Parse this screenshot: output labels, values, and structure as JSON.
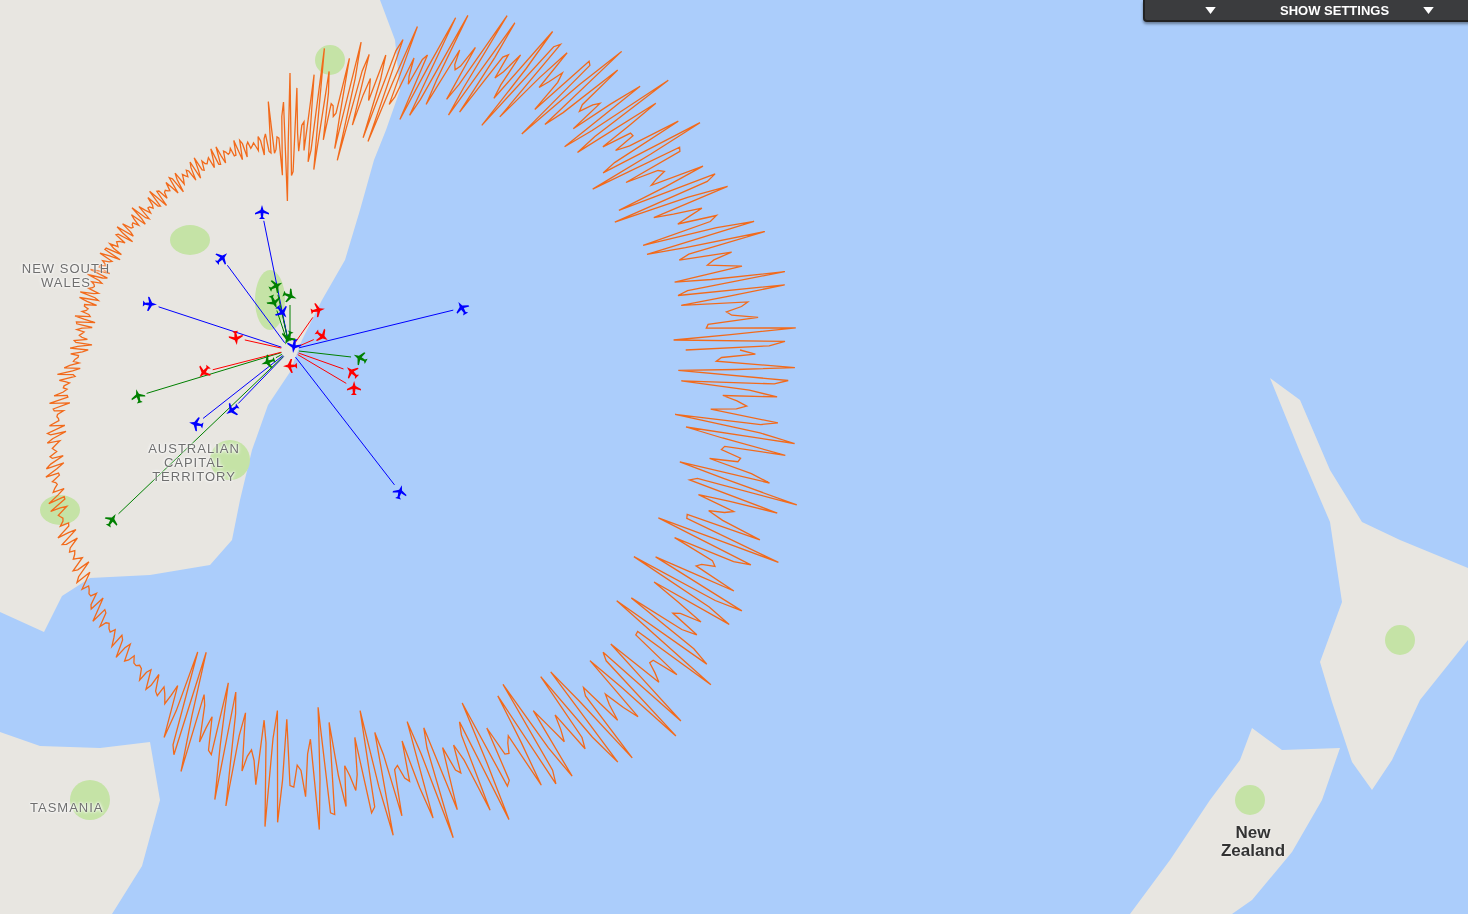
{
  "map": {
    "labels": [
      {
        "text": "NEW SOUTH WALES",
        "kind": "region"
      },
      {
        "text": "AUSTRALIAN CAPITAL TERRITORY",
        "kind": "region"
      },
      {
        "text": "TASMANIA",
        "kind": "region"
      },
      {
        "text": "New Zealand",
        "kind": "country"
      }
    ],
    "aircraft": [
      {
        "color": "#0000ff"
      },
      {
        "color": "#0000ff"
      },
      {
        "color": "#0000ff"
      },
      {
        "color": "#0000ff"
      },
      {
        "color": "#0000ff"
      },
      {
        "color": "#0000ff"
      },
      {
        "color": "#0000ff"
      },
      {
        "color": "#0000ff"
      },
      {
        "color": "#0000ff"
      },
      {
        "color": "#008000"
      },
      {
        "color": "#008000"
      },
      {
        "color": "#008000"
      },
      {
        "color": "#008000"
      },
      {
        "color": "#008000"
      },
      {
        "color": "#008000"
      },
      {
        "color": "#008000"
      },
      {
        "color": "#008000"
      },
      {
        "color": "#ff0000"
      },
      {
        "color": "#ff0000"
      },
      {
        "color": "#ff0000"
      },
      {
        "color": "#ff0000"
      },
      {
        "color": "#ff0000"
      },
      {
        "color": "#ff0000"
      },
      {
        "color": "#ff0000"
      }
    ]
  },
  "settings_bar": {
    "button": "SHOW SETTINGS"
  }
}
